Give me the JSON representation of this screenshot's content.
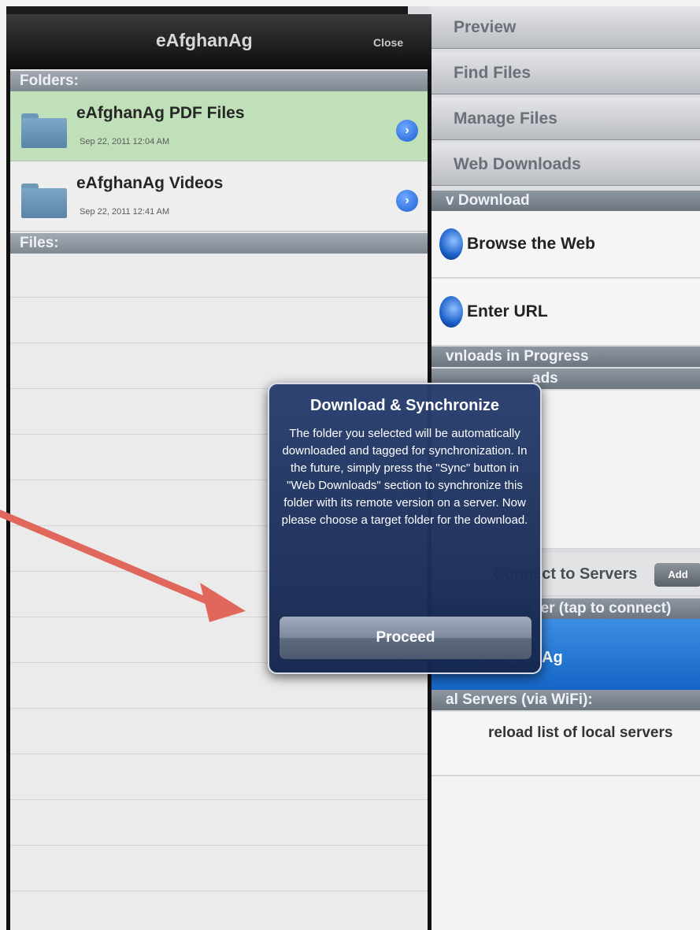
{
  "right_panel": {
    "menu_buttons": [
      "Preview",
      "Find Files",
      "Manage Files",
      "Web Downloads"
    ],
    "new_download_header": "v Download",
    "browse_label": "Browse the Web",
    "enter_url_label": "Enter URL",
    "downloads_in_progress_header": "vnloads in Progress",
    "downloads_header_partial": "ads",
    "connect_label": "Connect to Servers",
    "add_label": "Add",
    "server_header": "ver (tap to connect)",
    "server_name": "eAfghanAg",
    "local_servers_header": "al Servers (via WiFi):",
    "reload_label": "reload list of local servers"
  },
  "left_panel": {
    "title": "eAfghanAg",
    "close_label": "Close",
    "folders_header": "Folders:",
    "folders": [
      {
        "name": "eAfghanAg PDF Files",
        "date": "Sep 22, 2011 12:04 AM",
        "highlighted": true
      },
      {
        "name": "eAfghanAg Videos",
        "date": "Sep 22, 2011 12:41 AM",
        "highlighted": false
      }
    ],
    "files_header": "Files:"
  },
  "alert": {
    "title": "Download & Synchronize",
    "message": "The folder you selected will be automatically downloaded and tagged for synchronization. In the future, simply press the \"Sync\" button in \"Web Downloads\" section to synchronize this folder with its remote version on a server. Now please choose a target folder for the download.",
    "button_label": "Proceed"
  },
  "colors": {
    "highlight_row": "#bfe0b8",
    "alert_bg": "#22386b",
    "annotation_arrow": "#e0675c"
  }
}
